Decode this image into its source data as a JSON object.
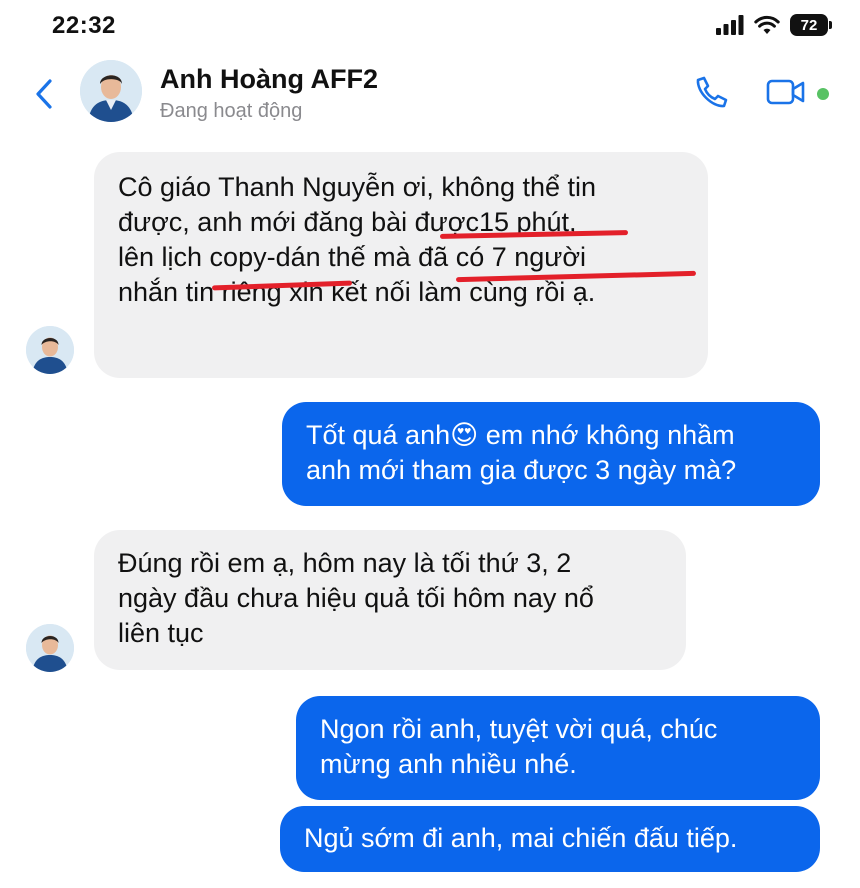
{
  "status_bar": {
    "time": "22:32",
    "battery": "72",
    "icons": [
      "signal-icon",
      "wifi-icon",
      "battery-icon"
    ]
  },
  "header": {
    "contact_name": "Anh Hoàng AFF2",
    "status": "Đang hoạt động",
    "icons": [
      "back-chevron-icon",
      "phone-icon",
      "video-camera-icon"
    ],
    "online_color": "#58c264"
  },
  "colors": {
    "accent": "#0b66ec",
    "incoming_bubble": "#f0f0f1",
    "annotation_underline": "#e3202a"
  },
  "messages": [
    {
      "direction": "incoming",
      "text": "Cô giáo Thanh Nguyễn ơi, không thể tin\nđược, anh mới đăng bài được15 phút,\nlên lịch copy-dán thế mà đã có 7 người\nnhắn tin riêng xin kết nối làm cùng rồi ạ."
    },
    {
      "direction": "outgoing",
      "text": "Tốt quá anh😍 em nhớ không nhầm\nanh mới tham gia được 3 ngày mà?"
    },
    {
      "direction": "incoming",
      "text": "Đúng rồi em ạ, hôm nay là tối thứ 3, 2\nngày đầu chưa hiệu quả tối hôm nay nổ\nliên tục"
    },
    {
      "direction": "outgoing",
      "text": "Ngon rồi anh, tuyệt vời quá, chúc\nmừng anh nhiều nhé."
    },
    {
      "direction": "outgoing",
      "text": "Ngủ sớm đi anh, mai chiến đấu tiếp."
    }
  ]
}
